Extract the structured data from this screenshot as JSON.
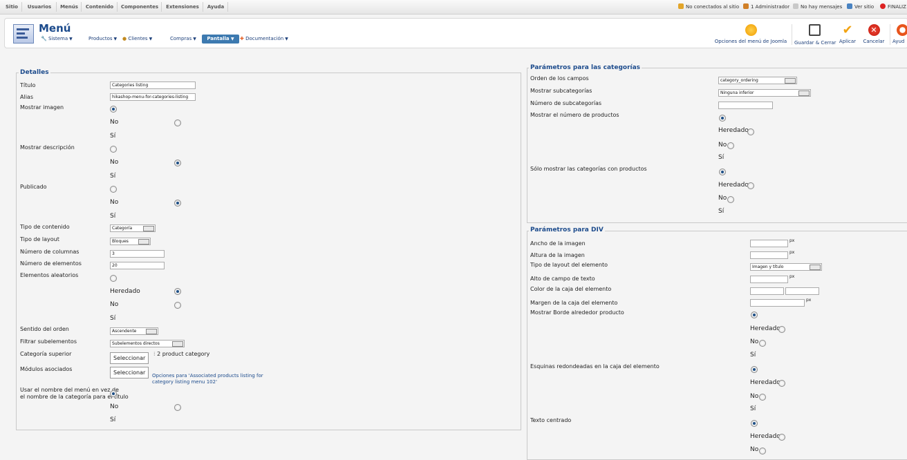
{
  "topmenu": [
    "Sitio",
    "Usuarios",
    "Menús",
    "Contenido",
    "Componentes",
    "Extensiones",
    "Ayuda"
  ],
  "status": {
    "visitors": "No conectados al sitio",
    "admins": "1 Administrador",
    "messages": "No hay mensajes",
    "view_site": "Ver sitio",
    "finalize": "FINALIZ"
  },
  "header": {
    "title": "Menú",
    "submenu": {
      "sistema": "Sistema",
      "productos": "Productos",
      "clientes": "Clientes",
      "compras": "Compras",
      "pantalla": "Pantalla",
      "documentacion": "Documentación"
    },
    "toolbar": {
      "options": "Opciones del menú de Joomla",
      "save_close": "Guardar & Cerrar",
      "apply": "Aplicar",
      "cancel": "Cancelar",
      "help": "Ayud"
    }
  },
  "details": {
    "legend": "Detalles",
    "titulo_label": "Título",
    "titulo_value": "Categories listing",
    "alias_label": "Alias",
    "alias_value": "hikashop-menu-for-categories-listing",
    "mostrar_imagen": "Mostrar imagen",
    "mostrar_descripcion": "Mostrar descripción",
    "publicado": "Publicado",
    "tipo_contenido_label": "Tipo de contenido",
    "tipo_contenido_value": "Categoría",
    "tipo_layout_label": "Tipo de layout",
    "tipo_layout_value": "Bloques",
    "num_columnas_label": "Número de columnas",
    "num_columnas_value": "3",
    "num_elementos_label": "Número de elementos",
    "num_elementos_value": "20",
    "elementos_aleatorios": "Elementos aleatorios",
    "sentido_orden_label": "Sentido del orden",
    "sentido_orden_value": "Ascendente",
    "filtrar_label": "Filtrar subelementos",
    "filtrar_value": "Subelementos directos",
    "categoria_superior_label": "Categoría superior",
    "seleccionar": "Seleccionar",
    "categoria_superior_value": "2 product category",
    "modulos_label": "Módulos asociados",
    "modulos_link": "Opciones para 'Associated products listing for category listing menu 102'",
    "usar_nombre_line1": "Usar el nombre del menú en vez de",
    "usar_nombre_line2": "el nombre de la categoría para el título"
  },
  "options": {
    "no": "No",
    "si": "Sí",
    "heredado": "Heredado"
  },
  "category_params": {
    "legend": "Parámetros para las categorías",
    "orden_label": "Orden de los campos",
    "orden_value": "category_ordering",
    "mostrar_sub_label": "Mostrar subcategorías",
    "mostrar_sub_value": "Ninguna inferior",
    "num_sub_label": "Número de subcategorías",
    "num_sub_value": "",
    "mostrar_num_productos": "Mostrar el número de productos",
    "solo_mostrar": "Sólo mostrar las categorías con productos"
  },
  "div_params": {
    "legend": "Parámetros para DIV",
    "ancho_imagen": "Ancho de la imagen",
    "altura_imagen": "Altura de la imagen",
    "tipo_layout_elemento": "Tipo de layout del elemento",
    "tipo_layout_elemento_value": "Imagen y título",
    "alto_campo_texto": "Alto de campo de texto",
    "color_caja": "Color de la caja del elemento",
    "margen_caja": "Margen de la caja del elemento",
    "mostrar_borde": "Mostrar Borde alrededor producto",
    "esquinas": "Esquinas redondeadas en la caja del elemento",
    "texto_centrado": "Texto centrado",
    "px": "px"
  },
  "colors": {
    "accent": "#1c4b8c",
    "pantalla_bg": "#3d7ab0"
  }
}
